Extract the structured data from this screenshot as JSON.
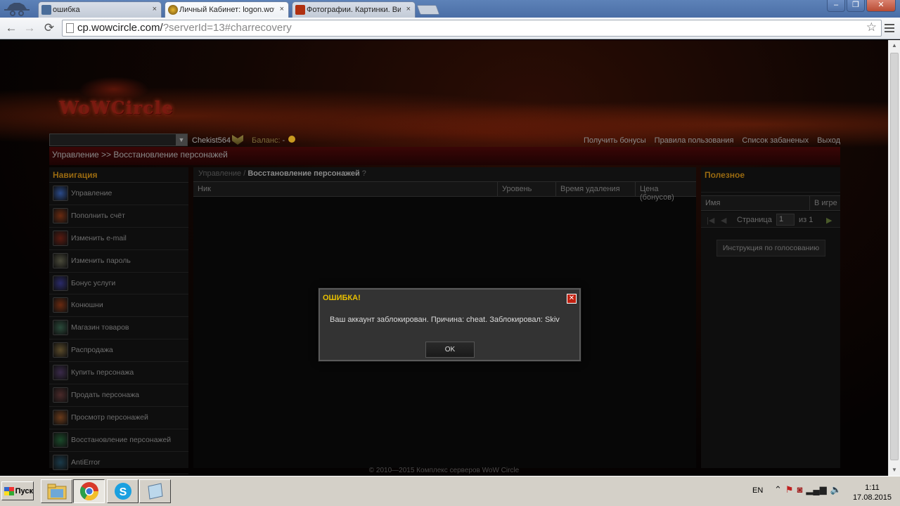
{
  "browser": {
    "tabs": [
      {
        "label": "ошибка",
        "active": false
      },
      {
        "label": "Личный Кабинет: logon.wow",
        "active": true
      },
      {
        "label": "Фотографии. Картинки. Ви",
        "active": false
      }
    ],
    "close_glyph": "×",
    "url_host": "cp.wowcircle.com/",
    "url_rest": "?serverId=13#charrecovery",
    "win_min": "–",
    "win_max": "❐",
    "win_close": "✕"
  },
  "header": {
    "logo_text": "WoWCircle"
  },
  "userbar": {
    "username": "Chekist564",
    "balance_label": "Баланс:",
    "balance_value": "-",
    "links": [
      "Получить бонусы",
      "Правила пользования",
      "Список забаненых",
      "Выход"
    ]
  },
  "breadcrumb": "Управление >> Восстановление персонажей",
  "nav": {
    "title": "Навигация",
    "items": [
      {
        "label": "Управление",
        "color": "#2a4a8a"
      },
      {
        "label": "Пополнить счёт",
        "color": "#6a2a10"
      },
      {
        "label": "Изменить e-mail",
        "color": "#5a1a10"
      },
      {
        "label": "Изменить пароль",
        "color": "#4a4a3a"
      },
      {
        "label": "Бонус услуги",
        "color": "#2a2a6a"
      },
      {
        "label": "Конюшни",
        "color": "#6a2a10"
      },
      {
        "label": "Магазин товаров",
        "color": "#2a4a3a"
      },
      {
        "label": "Распродажа",
        "color": "#5a4a2a"
      },
      {
        "label": "Купить персонажа",
        "color": "#3a2a4a"
      },
      {
        "label": "Продать персонажа",
        "color": "#4a2a2a"
      },
      {
        "label": "Просмотр персонажей",
        "color": "#6a3a1a"
      },
      {
        "label": "Восстановление персонажей",
        "color": "#1a4a2a"
      },
      {
        "label": "AntiError",
        "color": "#1a3a4a"
      }
    ]
  },
  "main": {
    "crumb_parent": "Управление",
    "crumb_current": "Восстановление персонажей",
    "columns": [
      "Ник",
      "Уровень",
      "Время удаления",
      "Цена (бонусов)"
    ]
  },
  "useful": {
    "title": "Полезное",
    "columns": [
      "Имя",
      "В игре"
    ],
    "pager": {
      "first": "|◀",
      "prev": "◀",
      "page_label": "Страница",
      "page_value": "1",
      "of_label": "из 1",
      "next": "▶"
    },
    "instruction_button": "Инструкция по голосованию"
  },
  "footer": "© 2010—2015 Комплекс серверов WoW Circle",
  "modal": {
    "title": "ОШИБКА!",
    "close_glyph": "✕",
    "message": "Ваш аккаунт заблокирован. Причина: cheat. Заблокировал: Skiv",
    "ok_label": "OK"
  },
  "taskbar": {
    "start_label": "Пуск",
    "lang": "EN",
    "time": "1:11",
    "date": "17.08.2015"
  }
}
